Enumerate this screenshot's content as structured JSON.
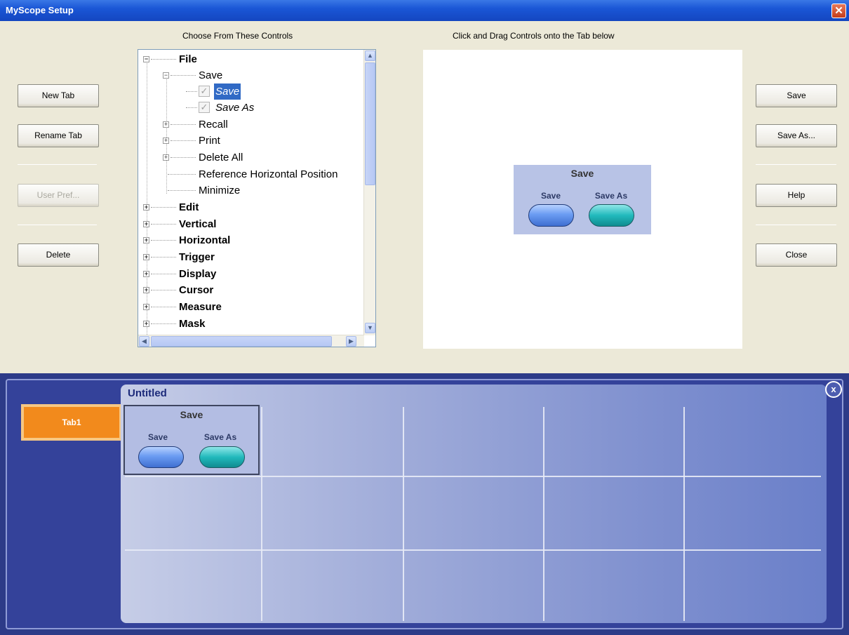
{
  "window": {
    "title": "MyScope Setup",
    "close_glyph": "✕"
  },
  "headings": {
    "controls": "Choose From These Controls",
    "drag": "Click and Drag Controls onto the Tab below"
  },
  "left_buttons": {
    "new_tab": "New Tab",
    "rename_tab": "Rename Tab",
    "user_pref": "User Pref...",
    "delete": "Delete"
  },
  "right_buttons": {
    "save": "Save",
    "save_as": "Save As...",
    "help": "Help",
    "close": "Close"
  },
  "tree": {
    "file": "File",
    "save_group": "Save",
    "save_item": "Save",
    "save_as_item": "Save As",
    "recall": "Recall",
    "print": "Print",
    "delete_all": "Delete All",
    "ref_horiz": "Reference Horizontal Position",
    "minimize": "Minimize",
    "edit": "Edit",
    "vertical": "Vertical",
    "horizontal": "Horizontal",
    "trigger": "Trigger",
    "display": "Display",
    "cursor": "Cursor",
    "measure": "Measure",
    "mask": "Mask"
  },
  "preview": {
    "group_title": "Save",
    "save_label": "Save",
    "save_as_label": "Save As"
  },
  "bottom": {
    "tab_label": "Tab1",
    "tab_title": "Untitled",
    "close_glyph": "x",
    "group_title": "Save",
    "save_label": "Save",
    "save_as_label": "Save As"
  },
  "colors": {
    "titlebar": "#1a56d6",
    "dialog_bg": "#ece9d8",
    "selection": "#316ac5",
    "tab_orange": "#f28a1c",
    "panel_navy": "#2d3b88"
  }
}
